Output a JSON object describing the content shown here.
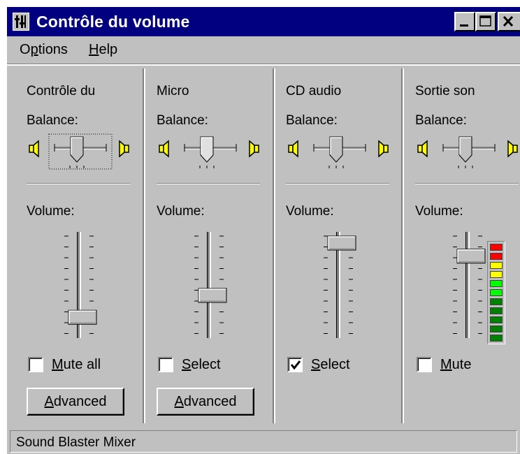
{
  "window": {
    "title": "Contrôle du volume",
    "status_text": "Sound Blaster Mixer"
  },
  "titlebar_buttons": [
    {
      "name": "minimize-button",
      "icon": "minimize-icon"
    },
    {
      "name": "maximize-button",
      "icon": "maximize-icon"
    },
    {
      "name": "close-button",
      "icon": "close-icon"
    }
  ],
  "menu": {
    "options_label": "Options",
    "help_label": "Help"
  },
  "channels": [
    {
      "title": "Contrôle du",
      "balance_label": "Balance:",
      "volume_label": "Volume:",
      "balance_value": 0.5,
      "volume_value": 0.15,
      "mute_label": "Mute all",
      "mute_checked": false,
      "advanced_label": "Advanced",
      "focused": true
    },
    {
      "title": "Micro",
      "balance_label": "Balance:",
      "volume_label": "Volume:",
      "balance_value": 0.5,
      "volume_value": 0.4,
      "mute_label": "Select",
      "mute_checked": false,
      "advanced_label": "Advanced"
    },
    {
      "title": "CD audio",
      "balance_label": "Balance:",
      "volume_label": "Volume:",
      "balance_value": 0.5,
      "volume_value": 1.0,
      "mute_label": "Select",
      "mute_checked": true
    },
    {
      "title": "Sortie son",
      "balance_label": "Balance:",
      "volume_label": "Volume:",
      "balance_value": 0.5,
      "volume_value": 0.85,
      "mute_label": "Mute",
      "mute_checked": false
    }
  ],
  "level_meter": {
    "colors": [
      "#ff0000",
      "#ff0000",
      "#ffff00",
      "#ffff00",
      "#00ff00",
      "#00ff00",
      "#008000",
      "#008000",
      "#008000",
      "#008000",
      "#008000"
    ]
  }
}
